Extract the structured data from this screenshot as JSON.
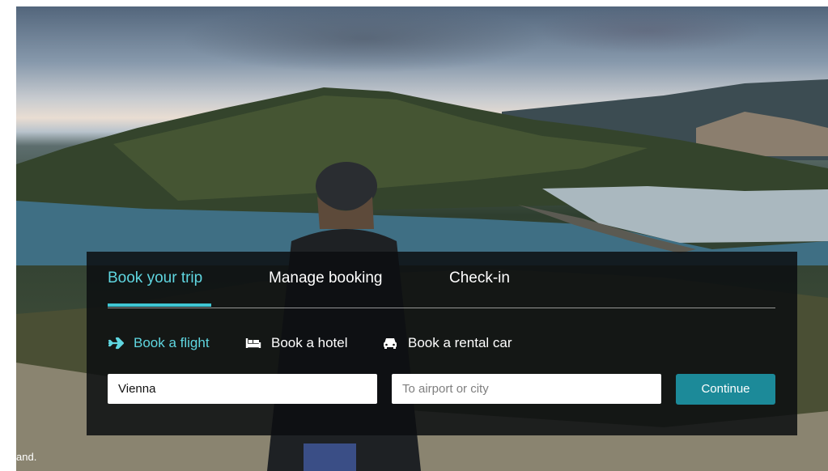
{
  "hero": {
    "caption": "and."
  },
  "tabs": [
    {
      "label": "Book your trip",
      "active": true
    },
    {
      "label": "Manage booking",
      "active": false
    },
    {
      "label": "Check-in",
      "active": false
    }
  ],
  "booking_options": [
    {
      "label": "Book a flight",
      "icon": "airplane-icon",
      "active": true
    },
    {
      "label": "Book a hotel",
      "icon": "bed-icon",
      "active": false
    },
    {
      "label": "Book a rental car",
      "icon": "car-icon",
      "active": false
    }
  ],
  "form": {
    "from_value": "Vienna",
    "to_placeholder": "To airport or city",
    "continue_label": "Continue"
  },
  "colors": {
    "accent": "#3fc6d3",
    "button": "#1c8a99",
    "panel": "#0c0e10"
  }
}
